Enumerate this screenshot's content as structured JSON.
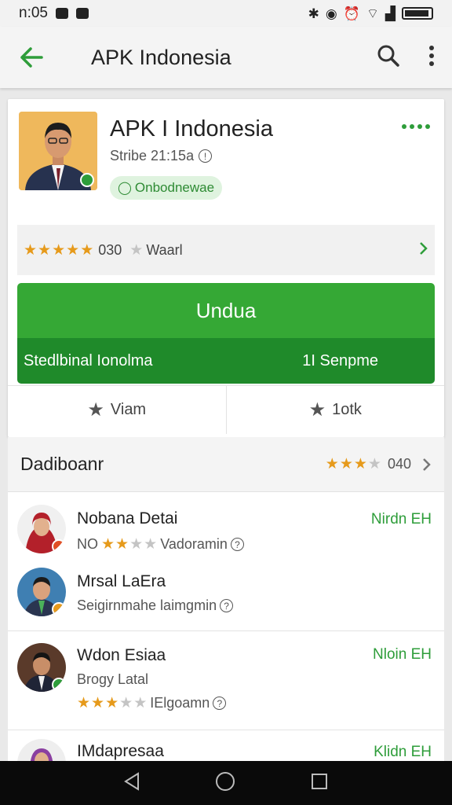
{
  "status": {
    "time": "n:05"
  },
  "appbar": {
    "title": "APK Indonesia"
  },
  "app": {
    "title": "APK I Indonesia",
    "subtitle": "Stribe 21:15a",
    "chip": "Onbodnewae"
  },
  "rating_strip": {
    "count": "030",
    "label": "Waarl",
    "stars": 5
  },
  "install": {
    "label": "Undua",
    "left": "Stedlbinal Ionolma",
    "right": "1I Senpme"
  },
  "split": {
    "left": "Viam",
    "right": "1otk"
  },
  "section": {
    "title": "Dadiboanr",
    "count": "040",
    "stars": 3
  },
  "reviews": [
    {
      "name": "Nobana Detai",
      "tag": "Nirdn EH",
      "line": "NO",
      "line2": "Vadoramin",
      "stars": 2
    },
    {
      "name": "Mrsal LaEra",
      "tag": "",
      "line": "Seigirnmahe laimgmin",
      "line2": "",
      "stars": 0
    },
    {
      "name": "Wdon Esiaa",
      "tag": "Nloin EH",
      "line": "Brogy Latal",
      "line2": "IElgoamn",
      "stars": 3
    },
    {
      "name": "IMdapresaa",
      "tag": "Klidn EH",
      "line": "",
      "line2": "",
      "stars": 0
    }
  ],
  "colors": {
    "accent": "#35a835",
    "dark_accent": "#1f8a2a",
    "star": "#e69a1b"
  }
}
